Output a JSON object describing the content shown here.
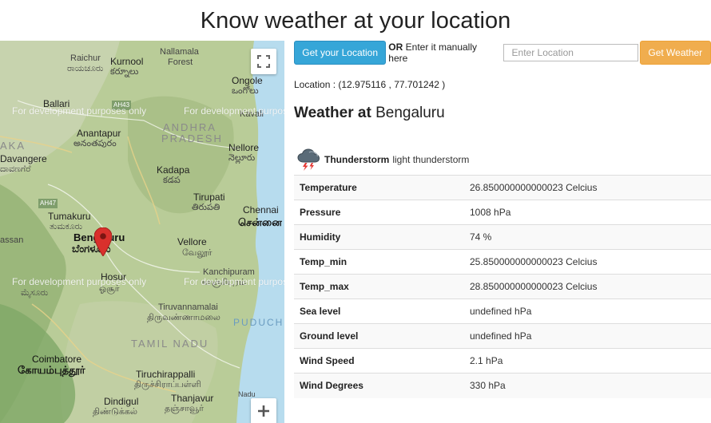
{
  "page": {
    "title": "Know weather at your location"
  },
  "map": {
    "watermark": "For development purposes only",
    "labels": {
      "raichur": "Raichur",
      "raichur_kn": "ರಾಯಚೂರು",
      "kurnool": "Kurnool",
      "kurnool_te": "కర్నూలు",
      "nallamala": "Nallamala",
      "forest": "Forest",
      "ongole": "Ongole",
      "ongole_te": "ఒంగోలు",
      "ballari": "Ballari",
      "kavali": "Kavali",
      "aka": "AKA",
      "andhra": "ANDHRA",
      "pradesh": "PRADESH",
      "anantapur": "Anantapur",
      "anantapur_te": "అనంతపురం",
      "nellore": "Nellore",
      "nellore_te": "నెల్లూరు",
      "davangere": "Davangere",
      "davangere_kn": "ದಾವಣಗೆರೆ",
      "kadapa": "Kadapa",
      "kadapa_te": "కడప",
      "ah47": "AH47",
      "ah43": "AH43",
      "tirupati": "Tirupati",
      "tirupati_te": "తిరుపతి",
      "tumakuru": "Tumakuru",
      "tumakuru_kn": "ತುಮಕೂರು",
      "chennai": "Chennai",
      "chennai_ta": "சென்னை",
      "hassan": "assan",
      "bengaluru": "Bengaluru",
      "bengaluru_kn": "ಬೆಂಗಳೂರು",
      "vellore": "Vellore",
      "vellore_ta": "வேலூர்",
      "kanchipuram": "Kanchipuram",
      "kanchipuram_ta": "காஞ்சிபுரம்",
      "hosur": "Hosur",
      "hosur_ta": "ஓசூர்",
      "mysuru_kn": "ಮೈಸೂರು",
      "tiruvannamalai": "Tiruvannamalai",
      "tiruvannamalai_ta": "திருவண்ணாமலை",
      "puducherry": "PUDUCH",
      "tamil_nadu": "TAMIL NADU",
      "coimbatore": "Coimbatore",
      "coimbatore_ta": "கோயம்புத்தூர்",
      "tiruchirappalli": "Tiruchirappalli",
      "tiruchirappalli_ta": "திருச்சிராப்பள்ளி",
      "dindigul": "Dindigul",
      "dindigul_ta": "திண்டுக்கல்",
      "thanjavur": "Thanjavur",
      "thanjavur_ta": "தஞ்சாவூர்",
      "nadu_small": "Nadu"
    }
  },
  "controls": {
    "get_location_label": "Get your Location",
    "or_label": "OR",
    "manual_label": "Enter it manually here",
    "location_placeholder": "Enter Location",
    "get_weather_label": "Get Weather"
  },
  "location_line": "Location : (12.975116 , 77.701242 )",
  "weather": {
    "heading_prefix": "Weather at",
    "city": "Bengaluru",
    "condition_main": "Thunderstorm",
    "condition_desc": "light thunderstorm",
    "icon": "thunderstorm-icon",
    "rows": [
      {
        "key": "Temperature",
        "value": "26.850000000000023 Celcius"
      },
      {
        "key": "Pressure",
        "value": "1008 hPa"
      },
      {
        "key": "Humidity",
        "value": "74 %"
      },
      {
        "key": "Temp_min",
        "value": "25.850000000000023 Celcius"
      },
      {
        "key": "Temp_max",
        "value": "28.850000000000023 Celcius"
      },
      {
        "key": "Sea level",
        "value": "undefined hPa"
      },
      {
        "key": "Ground level",
        "value": "undefined hPa"
      },
      {
        "key": "Wind Speed",
        "value": "2.1 hPa"
      },
      {
        "key": "Wind Degrees",
        "value": "330 hPa"
      }
    ]
  },
  "colors": {
    "primary_button": "#36a6d8",
    "warning_button": "#f0ad4e",
    "marker": "#d9302c"
  }
}
